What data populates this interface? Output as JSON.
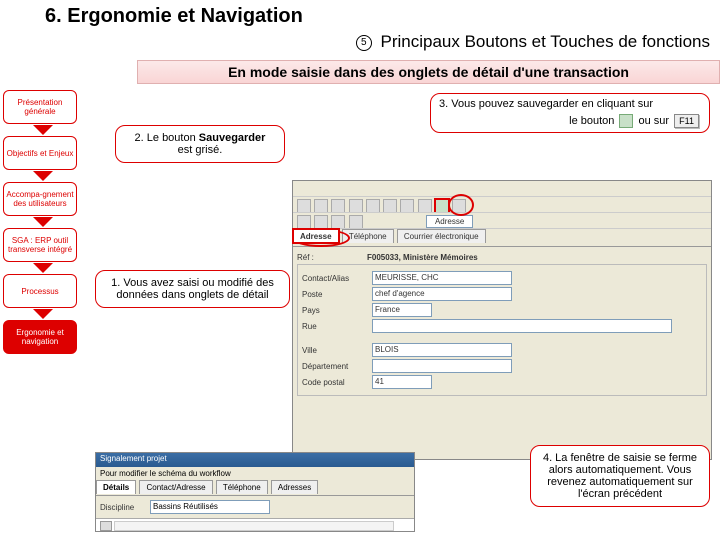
{
  "title": "6. Ergonomie et Navigation",
  "subtitle_num": "5",
  "subtitle": "Principaux Boutons et Touches de fonctions",
  "banner": "En mode saisie dans des onglets de détail d'une transaction",
  "sidebar": {
    "items": [
      "Présentation générale",
      "Objectifs et Enjeux",
      "Accompa-gnement des utilisateurs",
      "SGA : ERP outil transverse intégré",
      "Processus",
      "Ergonomie et navigation"
    ]
  },
  "callouts": {
    "c1": "1. Vous avez saisi ou modifié des données dans onglets de détail",
    "c2a": "2. Le bouton",
    "c2b": "Sauvegarder",
    "c2c": "est grisé.",
    "c3": "3. Vous pouvez sauvegarder en cliquant sur",
    "c3b_pre": "le bouton",
    "c3b_mid": "ou sur",
    "c3b_key": "F11",
    "c4": "4. La fenêtre de saisie se ferme alors automatiquement. Vous revenez automatiquement sur l'écran précédent"
  },
  "screenshot": {
    "tabs_top": [
      "Adresse",
      "Téléphone",
      "Courrier électronique"
    ],
    "adresse_btn": "Adresse",
    "ref_label": "Réf :",
    "ref_value": "F005033, Ministère Mémoires",
    "form": {
      "contact_label": "Contact/Alias",
      "contact_value": "MEURISSE, CHC",
      "poste_label": "Poste",
      "poste_value": "chef d'agence",
      "pays_label": "Pays",
      "pays_value": "France",
      "rue_label": "Rue",
      "ville_label": "Ville",
      "ville_value": "BLOIS",
      "dept_label": "Département",
      "cp_label": "Code postal",
      "cp_value": "41"
    }
  },
  "mini": {
    "title": "Signalement projet",
    "hint": "Pour modifier le schéma du workflow",
    "tabs": [
      "Détails",
      "Contact/Adresse",
      "Téléphone",
      "Adresses"
    ],
    "field_label": "Discipline",
    "field_value": "Bassins Réutilisés"
  }
}
